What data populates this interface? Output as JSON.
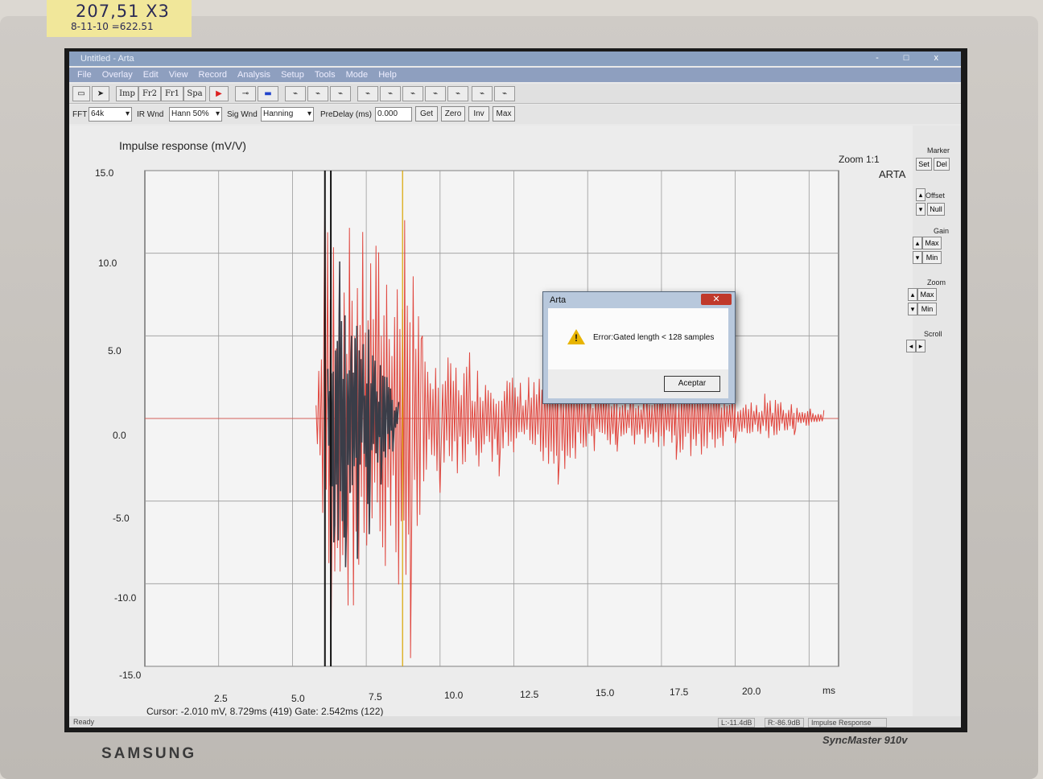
{
  "sticky_note": {
    "line1": "207,51 X3",
    "line2": "8-11-10 =622.51"
  },
  "window": {
    "title": "Untitled - Arta",
    "controls": "- □ x"
  },
  "menu": [
    "File",
    "Overlay",
    "Edit",
    "View",
    "Record",
    "Analysis",
    "Setup",
    "Tools",
    "Mode",
    "Help"
  ],
  "toolbar": {
    "imp": "Imp",
    "fr2": "Fr2",
    "fr1": "Fr1",
    "spa": "Spa"
  },
  "options": {
    "fft_label": "FFT",
    "fft_value": "64k",
    "ir_wnd_label": "IR Wnd",
    "ir_wnd_value": "Hann 50%",
    "sig_wnd_label": "Sig Wnd",
    "sig_wnd_value": "Hanning",
    "predelay_label": "PreDelay (ms)",
    "predelay_value": "0.000",
    "get": "Get",
    "zero": "Zero",
    "inv": "Inv",
    "max": "Max"
  },
  "plot": {
    "title": "Impulse response (mV/V)",
    "zoom": "Zoom 1:1",
    "watermark": "ARTA",
    "y_ticks": [
      "15.0",
      "10.0",
      "5.0",
      "0.0",
      "-5.0",
      "-10.0",
      "-15.0"
    ],
    "x_ticks": [
      "2.5",
      "5.0",
      "7.5",
      "10.0",
      "12.5",
      "15.0",
      "17.5",
      "20.0",
      "ms"
    ],
    "cursor": "Cursor: -2.010 mV, 8.729ms (419)  Gate: 2.542ms (122)"
  },
  "side_panel": {
    "marker": "Marker",
    "set": "Set",
    "del": "Del",
    "offset": "Offset",
    "null": "Null",
    "gain": "Gain",
    "gain_max": "Max",
    "gain_min": "Min",
    "zoom": "Zoom",
    "zoom_max": "Max",
    "zoom_min": "Min",
    "scroll": "Scroll"
  },
  "status": {
    "ready": "Ready",
    "left": "L:-11.4dB",
    "right": "R:-86.9dB",
    "mode": "Impulse Response"
  },
  "dialog": {
    "title": "Arta",
    "message": "Error:Gated length < 128 samples",
    "ok": "Aceptar"
  },
  "monitor": {
    "brand": "SAMSUNG",
    "model": "SyncMaster 910v"
  },
  "colors": {
    "gated_trace": "#3a3d48",
    "ungated_trace": "#e0463e",
    "grid": "#9a9a9a"
  },
  "chart_data": {
    "type": "line",
    "title": "Impulse response (mV/V)",
    "xlabel": "ms",
    "ylabel": "",
    "xlim": [
      0,
      23.5
    ],
    "ylim": [
      -15.0,
      15.0
    ],
    "grid": true,
    "series": [
      {
        "values_description": "",
        "x": [
          6.2,
          6.4,
          6.6,
          6.8,
          7.0,
          7.2,
          7.4,
          7.6,
          7.8,
          8.0,
          8.2,
          8.4,
          8.6
        ],
        "y": [
          3.0,
          -7.5,
          9.5,
          -9.0,
          5.0,
          -8.5,
          4.5,
          -7.0,
          3.5,
          -4.0,
          2.5,
          -2.0,
          1.0
        ]
      },
      {
        "values_description": "",
        "x": [
          5.8,
          6.1,
          6.3,
          8.8,
          9.0,
          9.4,
          10.0,
          11.0,
          12.0,
          13.0,
          14.0,
          15.0,
          16.0,
          17.0,
          18.0,
          19.0,
          20.0,
          21.0,
          22.0,
          23.0
        ],
        "y": [
          0.8,
          14.5,
          -14.5,
          12.0,
          -14.5,
          5.0,
          -4.5,
          4.0,
          -3.5,
          2.5,
          -4.0,
          2.5,
          -2.0,
          2.0,
          -2.5,
          3.0,
          -1.5,
          1.5,
          -1.0,
          0.5
        ]
      }
    ]
  }
}
